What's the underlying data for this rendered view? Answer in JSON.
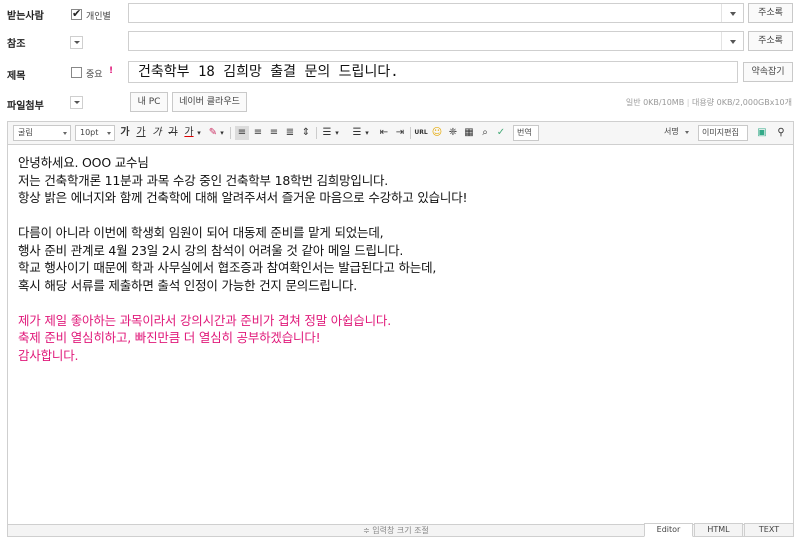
{
  "recipients": {
    "label": "받는사람",
    "individual_label": "개인별",
    "individual_checked": true,
    "address_book": "주소록"
  },
  "cc": {
    "label": "참조",
    "address_book": "주소록"
  },
  "subject": {
    "label": "제목",
    "important_label": "중요",
    "important_mark": "!",
    "value": "건축학부 18 김희망 출결 문의 드립니다.",
    "reservation_button": "약속잡기"
  },
  "attachment": {
    "label": "파일첨부",
    "my_pc": "내 PC",
    "naver_cloud": "네이버 클라우드",
    "quota_normal": "일반 0KB/10MB",
    "quota_large": "대용량 0KB/2,000GBx10개"
  },
  "toolbar": {
    "font": "굴림",
    "size": "10pt",
    "bold": "가",
    "underline": "가",
    "italic": "가",
    "strike": "가",
    "font_color": "가",
    "translate": "번역",
    "signature": "서명",
    "image_edit": "이미지편집"
  },
  "body": {
    "lines": [
      "안녕하세요. OOO 교수님",
      "저는 건축학개론 11분과 과목 수강 중인 건축학부 18학번 김희망입니다.",
      "항상 밝은 에너지와 함께 건축학에 대해 알려주셔서 즐거운 마음으로 수강하고 있습니다!",
      "다름이 아니라 이번에 학생회 임원이 되어 대동제 준비를 맡게 되었는데,",
      "행사 준비 관계로 4월 23일 2시 강의 참석이 어려울 것 같아 메일 드립니다.",
      "학교 행사이기 때문에 학과 사무실에서 협조증과 참여확인서는 발급된다고 하는데,",
      "혹시 해당 서류를 제출하면 출석 인정이 가능한 건지 문의드립니다.",
      "제가 제일 좋아하는 과목이라서 강의시간과 준비가 겹쳐 정말 아쉽습니다.",
      "축제 준비 열심히하고, 빠진만큼 더 열심히 공부하겠습니다!",
      "감사합니다."
    ],
    "highlight_color": "#e0197a"
  },
  "footer": {
    "resize": "≑ 입력창 크기 조절",
    "tabs": [
      "Editor",
      "HTML",
      "TEXT"
    ]
  }
}
